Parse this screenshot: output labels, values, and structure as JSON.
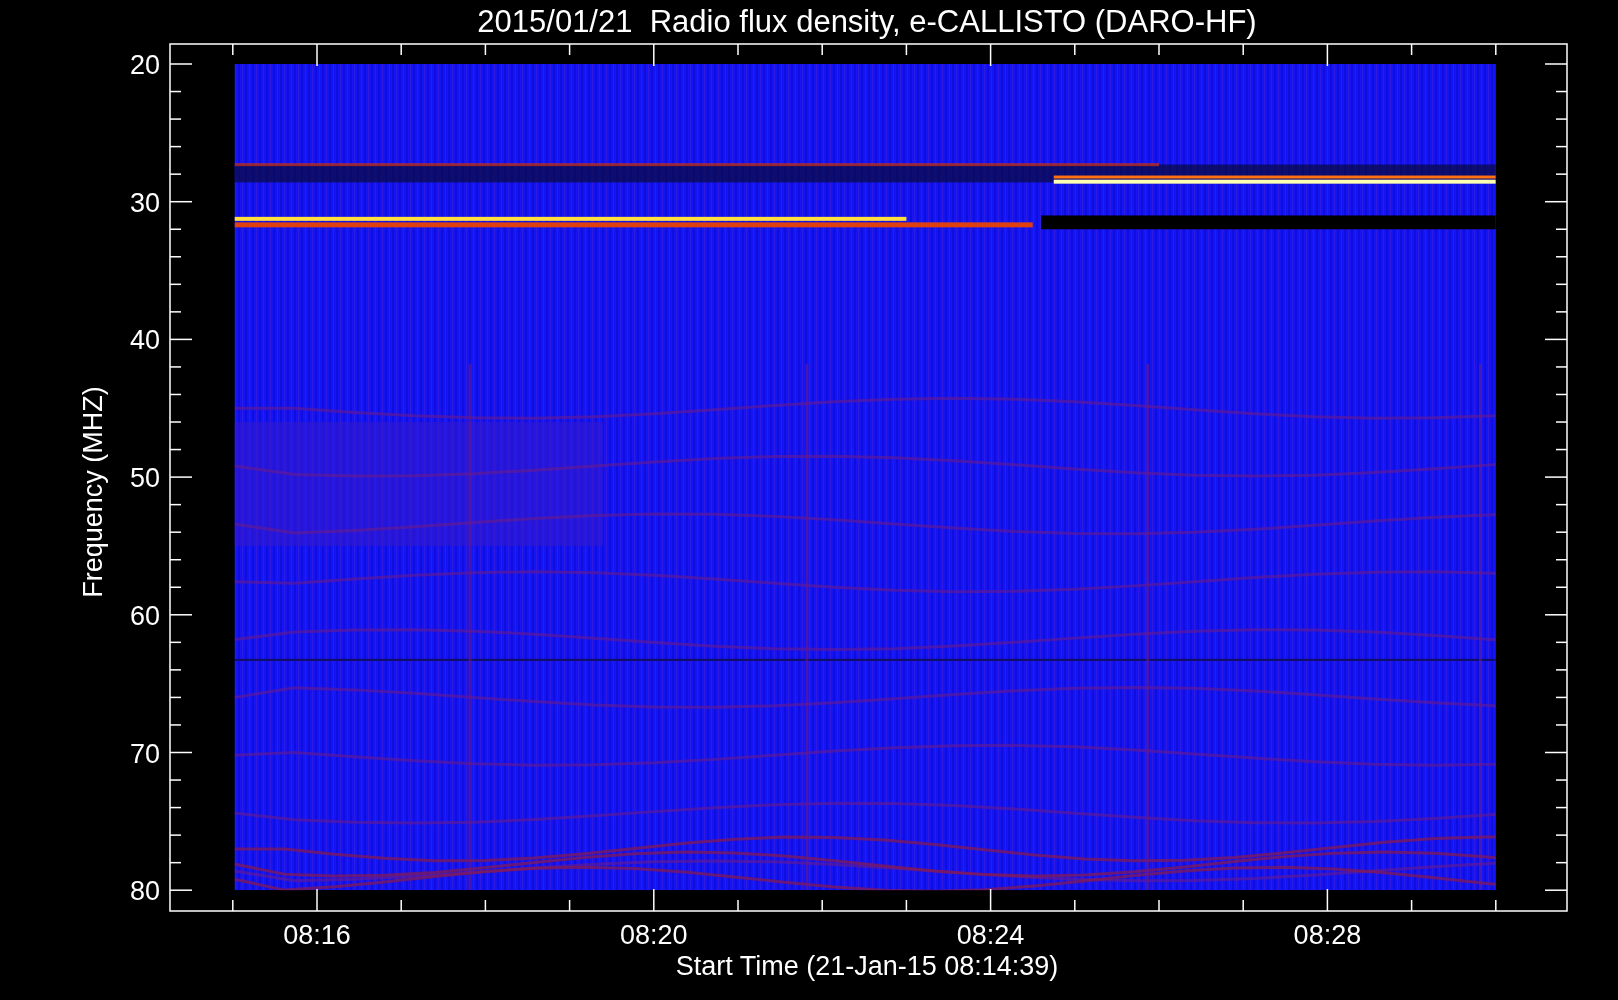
{
  "plot": {
    "title": "2015/01/21  Radio flux density, e-CALLISTO (DARO-HF)",
    "xlabel": "Start Time (21-Jan-15 08:14:39)",
    "ylabel": "Frequency (MHZ)",
    "yticks": [
      "20",
      "30",
      "40",
      "50",
      "60",
      "70",
      "80"
    ],
    "xticks": [
      "08:16",
      "08:20",
      "08:24",
      "08:28"
    ]
  }
}
